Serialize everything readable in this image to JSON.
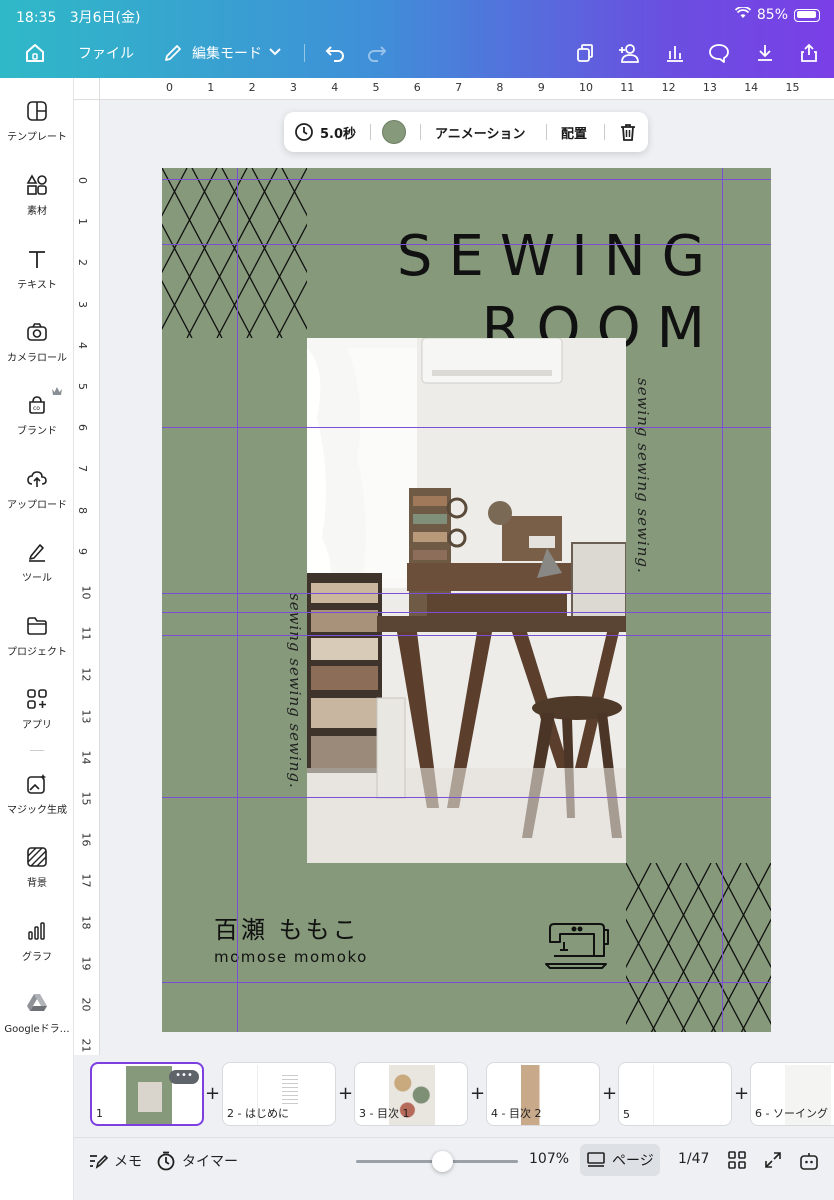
{
  "status_bar": {
    "time": "18:35",
    "date": "3月6日(金)",
    "battery": "85%"
  },
  "toolbar": {
    "file_label": "ファイル",
    "mode_label": "編集モード"
  },
  "sidebar": {
    "items": [
      {
        "label": "テンプレート",
        "icon": "template-icon"
      },
      {
        "label": "素材",
        "icon": "elements-icon"
      },
      {
        "label": "テキスト",
        "icon": "text-icon"
      },
      {
        "label": "カメラロール",
        "icon": "camera-icon"
      },
      {
        "label": "ブランド",
        "icon": "brand-icon"
      },
      {
        "label": "アップロード",
        "icon": "upload-icon"
      },
      {
        "label": "ツール",
        "icon": "draw-icon"
      },
      {
        "label": "プロジェクト",
        "icon": "folder-icon"
      },
      {
        "label": "アプリ",
        "icon": "apps-icon"
      },
      {
        "label": "マジック生成",
        "icon": "magic-icon"
      },
      {
        "label": "背景",
        "icon": "background-icon"
      },
      {
        "label": "グラフ",
        "icon": "chart-icon"
      },
      {
        "label": "Googleドラ…",
        "icon": "google-drive-icon"
      }
    ]
  },
  "ruler": {
    "top": [
      "0",
      "1",
      "2",
      "3",
      "4",
      "5",
      "6",
      "7",
      "8",
      "9",
      "10",
      "11",
      "12",
      "13",
      "14",
      "15"
    ],
    "left": [
      "0",
      "1",
      "2",
      "3",
      "4",
      "5",
      "6",
      "7",
      "8",
      "9",
      "10",
      "11",
      "12",
      "13",
      "14",
      "15",
      "16",
      "17",
      "18",
      "19",
      "20",
      "21"
    ]
  },
  "floating_toolbar": {
    "duration": "5.0秒",
    "color": "#869a7b",
    "animation_label": "アニメーション",
    "position_label": "配置"
  },
  "design": {
    "title_line1": "SEWING",
    "title_line2": "ROOM",
    "script_text": "sewing sewing sewing.",
    "author_jp": "百瀬 ももこ",
    "author_en": "momose momoko",
    "background_color": "#869a7b"
  },
  "pages": [
    {
      "label": "1"
    },
    {
      "label": "2 - はじめに"
    },
    {
      "label": "3 - 目次 1"
    },
    {
      "label": "4 - 目次 2"
    },
    {
      "label": "5"
    },
    {
      "label": "6 - ソーイング"
    }
  ],
  "bottom_bar": {
    "notes_label": "メモ",
    "timer_label": "タイマー",
    "zoom": "107%",
    "zoom_fraction": 0.53,
    "page_view_label": "ページ",
    "page_count": "1/47"
  }
}
